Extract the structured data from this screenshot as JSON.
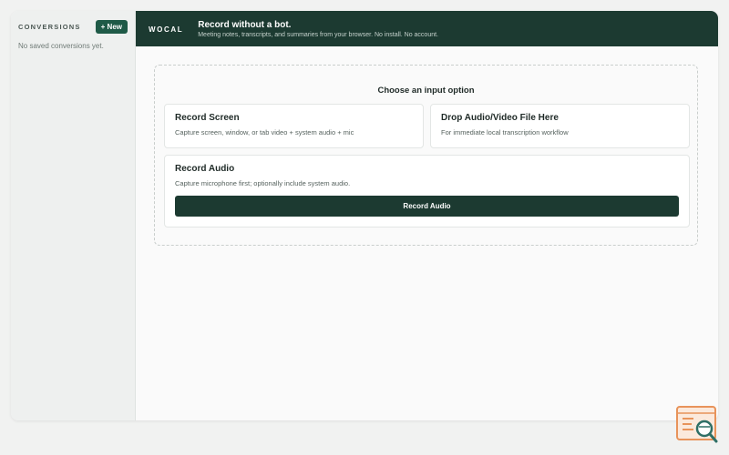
{
  "sidebar": {
    "title": "CONVERSIONS",
    "new_button_label": "+ New",
    "empty_text": "No saved conversions yet."
  },
  "header": {
    "brand": "WOCAL",
    "title": "Record without a bot.",
    "subtitle": "Meeting notes, transcripts, and summaries from your browser. No install. No account."
  },
  "main": {
    "heading": "Choose an input option",
    "options": [
      {
        "title": "Record Screen",
        "description": "Capture screen, window, or tab video + system audio + mic"
      },
      {
        "title": "Drop Audio/Video File Here",
        "description": "For immediate local transcription workflow"
      },
      {
        "title": "Record Audio",
        "description": "Capture microphone first; optionally include system audio.",
        "button_label": "Record Audio"
      }
    ]
  },
  "colors": {
    "accent_dark": "#1c3a31",
    "new_button": "#1f5a47",
    "logo_orange": "#e8935a",
    "logo_teal": "#2e6f66"
  },
  "icons": {
    "corner_logo": "document-search-logo-icon"
  }
}
